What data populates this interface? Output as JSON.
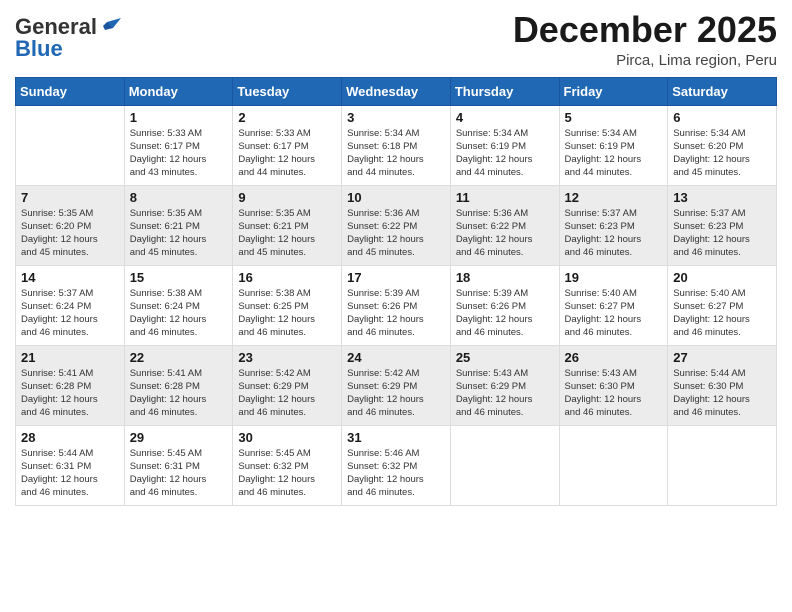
{
  "header": {
    "logo_general": "General",
    "logo_blue": "Blue",
    "month": "December 2025",
    "location": "Pirca, Lima region, Peru"
  },
  "days_of_week": [
    "Sunday",
    "Monday",
    "Tuesday",
    "Wednesday",
    "Thursday",
    "Friday",
    "Saturday"
  ],
  "weeks": [
    [
      {
        "day": "",
        "info": ""
      },
      {
        "day": "1",
        "info": "Sunrise: 5:33 AM\nSunset: 6:17 PM\nDaylight: 12 hours\nand 43 minutes."
      },
      {
        "day": "2",
        "info": "Sunrise: 5:33 AM\nSunset: 6:17 PM\nDaylight: 12 hours\nand 44 minutes."
      },
      {
        "day": "3",
        "info": "Sunrise: 5:34 AM\nSunset: 6:18 PM\nDaylight: 12 hours\nand 44 minutes."
      },
      {
        "day": "4",
        "info": "Sunrise: 5:34 AM\nSunset: 6:19 PM\nDaylight: 12 hours\nand 44 minutes."
      },
      {
        "day": "5",
        "info": "Sunrise: 5:34 AM\nSunset: 6:19 PM\nDaylight: 12 hours\nand 44 minutes."
      },
      {
        "day": "6",
        "info": "Sunrise: 5:34 AM\nSunset: 6:20 PM\nDaylight: 12 hours\nand 45 minutes."
      }
    ],
    [
      {
        "day": "7",
        "info": "Sunrise: 5:35 AM\nSunset: 6:20 PM\nDaylight: 12 hours\nand 45 minutes."
      },
      {
        "day": "8",
        "info": "Sunrise: 5:35 AM\nSunset: 6:21 PM\nDaylight: 12 hours\nand 45 minutes."
      },
      {
        "day": "9",
        "info": "Sunrise: 5:35 AM\nSunset: 6:21 PM\nDaylight: 12 hours\nand 45 minutes."
      },
      {
        "day": "10",
        "info": "Sunrise: 5:36 AM\nSunset: 6:22 PM\nDaylight: 12 hours\nand 45 minutes."
      },
      {
        "day": "11",
        "info": "Sunrise: 5:36 AM\nSunset: 6:22 PM\nDaylight: 12 hours\nand 46 minutes."
      },
      {
        "day": "12",
        "info": "Sunrise: 5:37 AM\nSunset: 6:23 PM\nDaylight: 12 hours\nand 46 minutes."
      },
      {
        "day": "13",
        "info": "Sunrise: 5:37 AM\nSunset: 6:23 PM\nDaylight: 12 hours\nand 46 minutes."
      }
    ],
    [
      {
        "day": "14",
        "info": "Sunrise: 5:37 AM\nSunset: 6:24 PM\nDaylight: 12 hours\nand 46 minutes."
      },
      {
        "day": "15",
        "info": "Sunrise: 5:38 AM\nSunset: 6:24 PM\nDaylight: 12 hours\nand 46 minutes."
      },
      {
        "day": "16",
        "info": "Sunrise: 5:38 AM\nSunset: 6:25 PM\nDaylight: 12 hours\nand 46 minutes."
      },
      {
        "day": "17",
        "info": "Sunrise: 5:39 AM\nSunset: 6:26 PM\nDaylight: 12 hours\nand 46 minutes."
      },
      {
        "day": "18",
        "info": "Sunrise: 5:39 AM\nSunset: 6:26 PM\nDaylight: 12 hours\nand 46 minutes."
      },
      {
        "day": "19",
        "info": "Sunrise: 5:40 AM\nSunset: 6:27 PM\nDaylight: 12 hours\nand 46 minutes."
      },
      {
        "day": "20",
        "info": "Sunrise: 5:40 AM\nSunset: 6:27 PM\nDaylight: 12 hours\nand 46 minutes."
      }
    ],
    [
      {
        "day": "21",
        "info": "Sunrise: 5:41 AM\nSunset: 6:28 PM\nDaylight: 12 hours\nand 46 minutes."
      },
      {
        "day": "22",
        "info": "Sunrise: 5:41 AM\nSunset: 6:28 PM\nDaylight: 12 hours\nand 46 minutes."
      },
      {
        "day": "23",
        "info": "Sunrise: 5:42 AM\nSunset: 6:29 PM\nDaylight: 12 hours\nand 46 minutes."
      },
      {
        "day": "24",
        "info": "Sunrise: 5:42 AM\nSunset: 6:29 PM\nDaylight: 12 hours\nand 46 minutes."
      },
      {
        "day": "25",
        "info": "Sunrise: 5:43 AM\nSunset: 6:29 PM\nDaylight: 12 hours\nand 46 minutes."
      },
      {
        "day": "26",
        "info": "Sunrise: 5:43 AM\nSunset: 6:30 PM\nDaylight: 12 hours\nand 46 minutes."
      },
      {
        "day": "27",
        "info": "Sunrise: 5:44 AM\nSunset: 6:30 PM\nDaylight: 12 hours\nand 46 minutes."
      }
    ],
    [
      {
        "day": "28",
        "info": "Sunrise: 5:44 AM\nSunset: 6:31 PM\nDaylight: 12 hours\nand 46 minutes."
      },
      {
        "day": "29",
        "info": "Sunrise: 5:45 AM\nSunset: 6:31 PM\nDaylight: 12 hours\nand 46 minutes."
      },
      {
        "day": "30",
        "info": "Sunrise: 5:45 AM\nSunset: 6:32 PM\nDaylight: 12 hours\nand 46 minutes."
      },
      {
        "day": "31",
        "info": "Sunrise: 5:46 AM\nSunset: 6:32 PM\nDaylight: 12 hours\nand 46 minutes."
      },
      {
        "day": "",
        "info": ""
      },
      {
        "day": "",
        "info": ""
      },
      {
        "day": "",
        "info": ""
      }
    ]
  ]
}
